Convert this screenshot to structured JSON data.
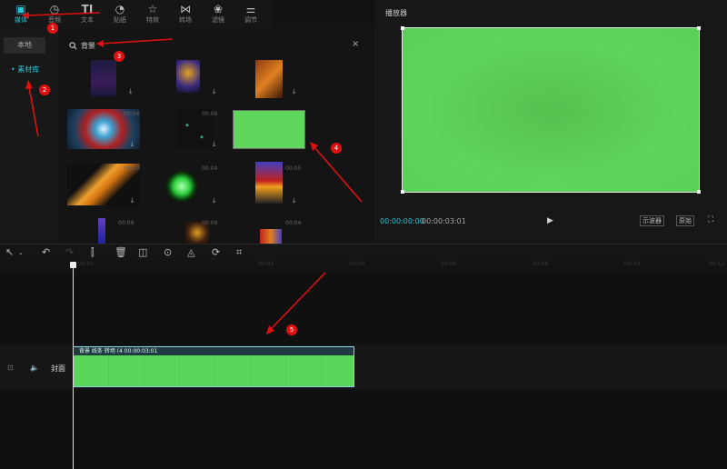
{
  "toolbar": {
    "tabs": [
      {
        "label": "媒体",
        "icon": "media-icon"
      },
      {
        "label": "音频",
        "icon": "audio-icon"
      },
      {
        "label": "文本",
        "icon": "text-icon"
      },
      {
        "label": "贴纸",
        "icon": "sticker-icon"
      },
      {
        "label": "特效",
        "icon": "effects-icon"
      },
      {
        "label": "转场",
        "icon": "transition-icon"
      },
      {
        "label": "滤镜",
        "icon": "filter-icon"
      },
      {
        "label": "调节",
        "icon": "adjust-icon"
      }
    ]
  },
  "sidebar": {
    "local": "本地",
    "library": "• 素材库"
  },
  "media": {
    "search_value": "背景",
    "thumbnails": [
      {
        "duration": ""
      },
      {
        "duration": ""
      },
      {
        "duration": ""
      },
      {
        "duration": "00:04"
      },
      {
        "duration": "00:09"
      },
      {
        "duration": ""
      },
      {
        "duration": "00:20"
      },
      {
        "duration": "00:04"
      },
      {
        "duration": "00:05"
      },
      {
        "duration": "00:09"
      },
      {
        "duration": "00:09"
      },
      {
        "duration": "00:04"
      }
    ]
  },
  "preview": {
    "title": "播放器",
    "time_current": "00:00:00:00",
    "time_total": "00:00:03:01",
    "scope_label": "示波器",
    "ratio_label": "原始"
  },
  "timeline": {
    "ruler_labels": [
      "00:00",
      "00:02",
      "00:04",
      "00:06",
      "00:08",
      "00:10",
      "00:12"
    ],
    "cover_label": "封面",
    "clip_label": "背景 线条 转场 (4     00:00:03:01"
  },
  "annotations": [
    "1",
    "2",
    "3",
    "4",
    "5"
  ],
  "colors": {
    "accent": "#2bc5d8",
    "badge": "#e01010",
    "clip_green": "#5cd55b"
  }
}
